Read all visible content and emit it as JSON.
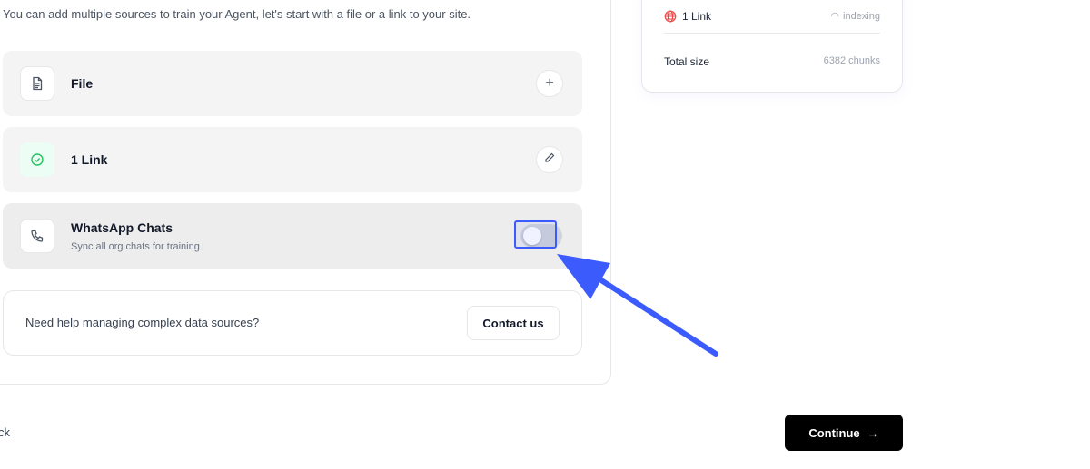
{
  "intro_text": "You can add multiple sources to train your Agent, let's start with a file or a link to your site.",
  "sources": [
    {
      "title": "File",
      "icon": "document-icon",
      "action": "add",
      "action_glyph": "+"
    },
    {
      "title": "1 Link",
      "icon": "check-circle-icon",
      "action": "edit",
      "action_icon": "pencil-icon"
    },
    {
      "title": "WhatsApp Chats",
      "subtitle": "Sync all org chats for training",
      "icon": "phone-icon",
      "action": "toggle",
      "toggle_on": false
    }
  ],
  "help": {
    "text": "Need help managing complex data sources?",
    "button_label": "Contact us"
  },
  "summary": {
    "link_label": "1 Link",
    "link_status": "indexing",
    "total_label": "Total size",
    "total_value": "6382 chunks"
  },
  "footer": {
    "back_label": "ck",
    "continue_label": "Continue",
    "continue_glyph": "→"
  },
  "colors": {
    "highlight": "#3b5bfd",
    "link_globe": "#ef4444",
    "check": "#22c55e",
    "continue_bg": "#000000"
  }
}
